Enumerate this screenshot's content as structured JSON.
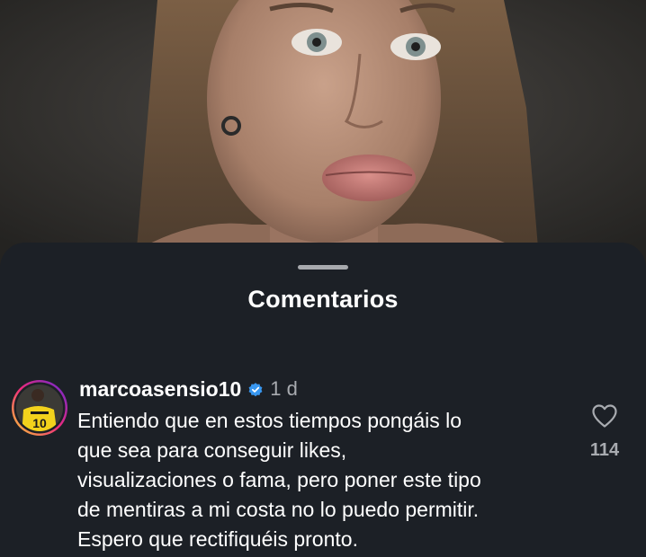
{
  "sheet": {
    "title": "Comentarios"
  },
  "comment": {
    "username": "marcoasensio10",
    "verified_icon": "verified-badge-icon",
    "timestamp": "1 d",
    "text_lines": [
      "Entiendo que en estos tiempos pongáis lo",
      "que sea para conseguir likes,",
      "visualizaciones o fama, pero poner este tipo",
      "de mentiras a mi costa no lo puedo permitir.",
      "Espero que rectifiquéis pronto."
    ],
    "likes": "114",
    "like_icon": "heart-outline-icon",
    "avatar_jersey_number": "10"
  },
  "colors": {
    "sheet_bg": "#1c2026",
    "text_primary": "#ffffff",
    "text_secondary": "#a8abb0",
    "verified_blue": "#3897f0"
  }
}
